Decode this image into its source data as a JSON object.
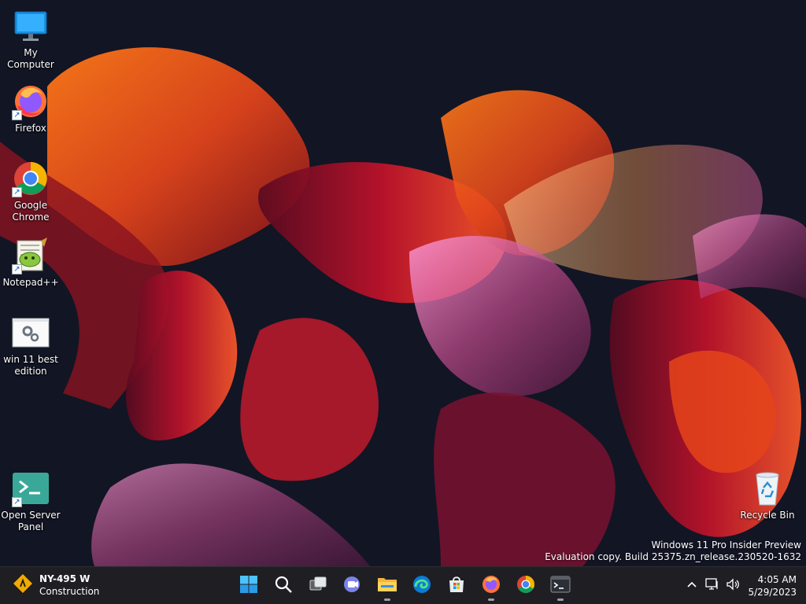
{
  "desktop": {
    "icons": [
      {
        "label": "My Computer"
      },
      {
        "label": "Firefox"
      },
      {
        "label": "Google Chrome"
      },
      {
        "label": "Notepad++"
      },
      {
        "label": "win 11 best edition"
      },
      {
        "label": "Open Server Panel"
      },
      {
        "label": "Recycle Bin"
      }
    ]
  },
  "watermark": {
    "line1": "Windows 11 Pro Insider Preview",
    "line2": "Evaluation copy. Build 25375.zn_release.230520-1632"
  },
  "taskbar": {
    "weather": {
      "title": "NY-495 W",
      "subtitle": "Construction"
    },
    "apps": [
      {
        "icon": "windows-start-icon"
      },
      {
        "icon": "search-icon"
      },
      {
        "icon": "task-view-icon"
      },
      {
        "icon": "teams-chat-icon"
      },
      {
        "icon": "file-explorer-icon"
      },
      {
        "icon": "edge-icon"
      },
      {
        "icon": "microsoft-store-icon"
      },
      {
        "icon": "firefox-icon"
      },
      {
        "icon": "chrome-icon"
      },
      {
        "icon": "terminal-icon"
      }
    ],
    "clock": {
      "time": "4:05 AM",
      "date": "5/29/2023"
    }
  },
  "colors": {
    "taskbar_bg": "#1f1f23",
    "wallpaper_bg": "#121524",
    "accent_orange": "#e0561c",
    "accent_red": "#b3122a",
    "accent_pink": "#d96aa8"
  }
}
